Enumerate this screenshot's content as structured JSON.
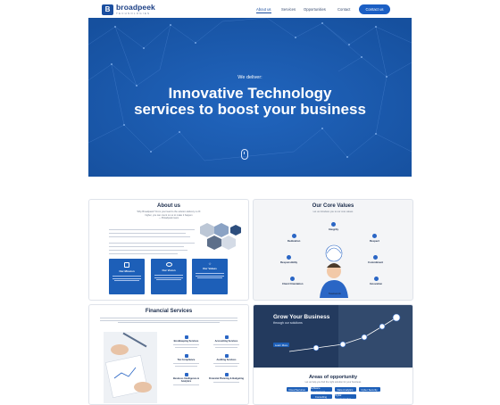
{
  "colors": {
    "brand": "#1b4fa0",
    "accent": "#1b5fc4",
    "hero": "#1b5cb0",
    "text": "#1a2b4a"
  },
  "header": {
    "logo_mark": "B",
    "logo_name": "broadpeek",
    "logo_tagline": "TECHNOLOGIES",
    "nav": [
      "About us",
      "Services",
      "Opportunities",
      "Contact"
    ],
    "cta": "Contact us"
  },
  "hero": {
    "subtitle": "We deliver:",
    "title_line1": "Innovative Technology",
    "title_line2": "services to boost your business",
    "scroll_icon": "mouse-scroll-icon"
  },
  "about": {
    "title": "About us",
    "quote_line1": "Why Broadpeek? From your lead to the solution delivery is 2X",
    "quote_line2": "higher, you can count on us to make it happen",
    "quote_author": "— Broadpeek team",
    "boxes": [
      {
        "icon": "flag-icon",
        "title": "Our Mission"
      },
      {
        "icon": "eye-icon",
        "title": "Our Vision"
      },
      {
        "icon": "star-icon",
        "title": "Our Values"
      }
    ]
  },
  "values": {
    "title": "Our Core Values",
    "subtitle": "Let us introduce you to our core values",
    "items": [
      "Integrity",
      "Dedication",
      "Respect",
      "Responsibility",
      "Commitment",
      "Innovation",
      "Client Orientation",
      "Teamwork"
    ]
  },
  "financial": {
    "title": "Financial Services",
    "services": [
      "Bookkeeping Services",
      "Accounting Services",
      "Tax Compliance",
      "Auditing Services",
      "Business Intelligence & Analytics",
      "Financial Planning & Budgeting"
    ]
  },
  "grow": {
    "title": "Grow Your Business",
    "subtitle": "through our solutions",
    "button": "Learn More"
  },
  "opportunity": {
    "title": "Areas of opportunity",
    "subtitle": "Let us help you find the right solution for your business",
    "tags": [
      "Cloud Services",
      "Software Development",
      "Data Analytics",
      "Cyber Security",
      "Consulting",
      "Digital Transformation"
    ]
  }
}
